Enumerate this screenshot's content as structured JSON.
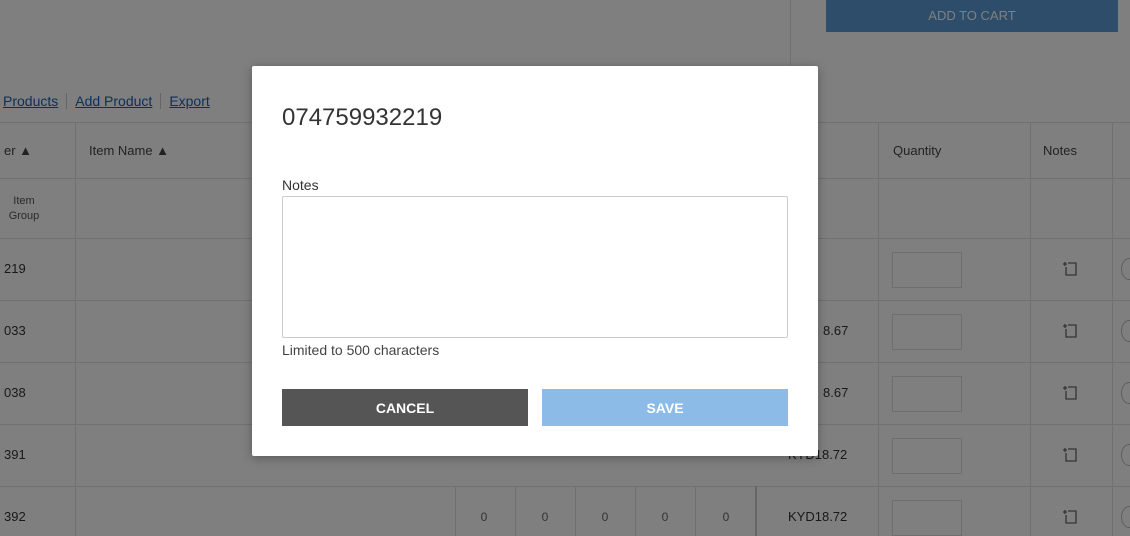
{
  "cart": {
    "add_to_cart": "ADD TO CART"
  },
  "links": [
    "Products",
    "Add Product",
    "Export"
  ],
  "table": {
    "headers": {
      "number": "er ▲",
      "item_name": "Item Name ▲",
      "quantity": "Quantity",
      "notes": "Notes"
    },
    "group_row_label": [
      "Item",
      "Group"
    ],
    "rows": [
      {
        "number": "219",
        "price": ""
      },
      {
        "number": "033",
        "price": "8.67"
      },
      {
        "number": "038",
        "price": "8.67"
      },
      {
        "number": "391",
        "price": "KYD18.72"
      },
      {
        "number": "392",
        "price": "KYD18.72",
        "zeros": [
          "0",
          "0",
          "0",
          "0",
          "0"
        ]
      }
    ]
  },
  "modal": {
    "title": "074759932219",
    "notes_label": "Notes",
    "notes_value": "",
    "hint": "Limited to 500 characters",
    "cancel": "CANCEL",
    "save": "SAVE"
  },
  "colors": {
    "primary": "#5b9bd5",
    "cancel": "#555555",
    "save_disabled": "#8bbbe6",
    "link": "#1a5fb4"
  },
  "icons": {
    "note": "note-add-icon"
  }
}
